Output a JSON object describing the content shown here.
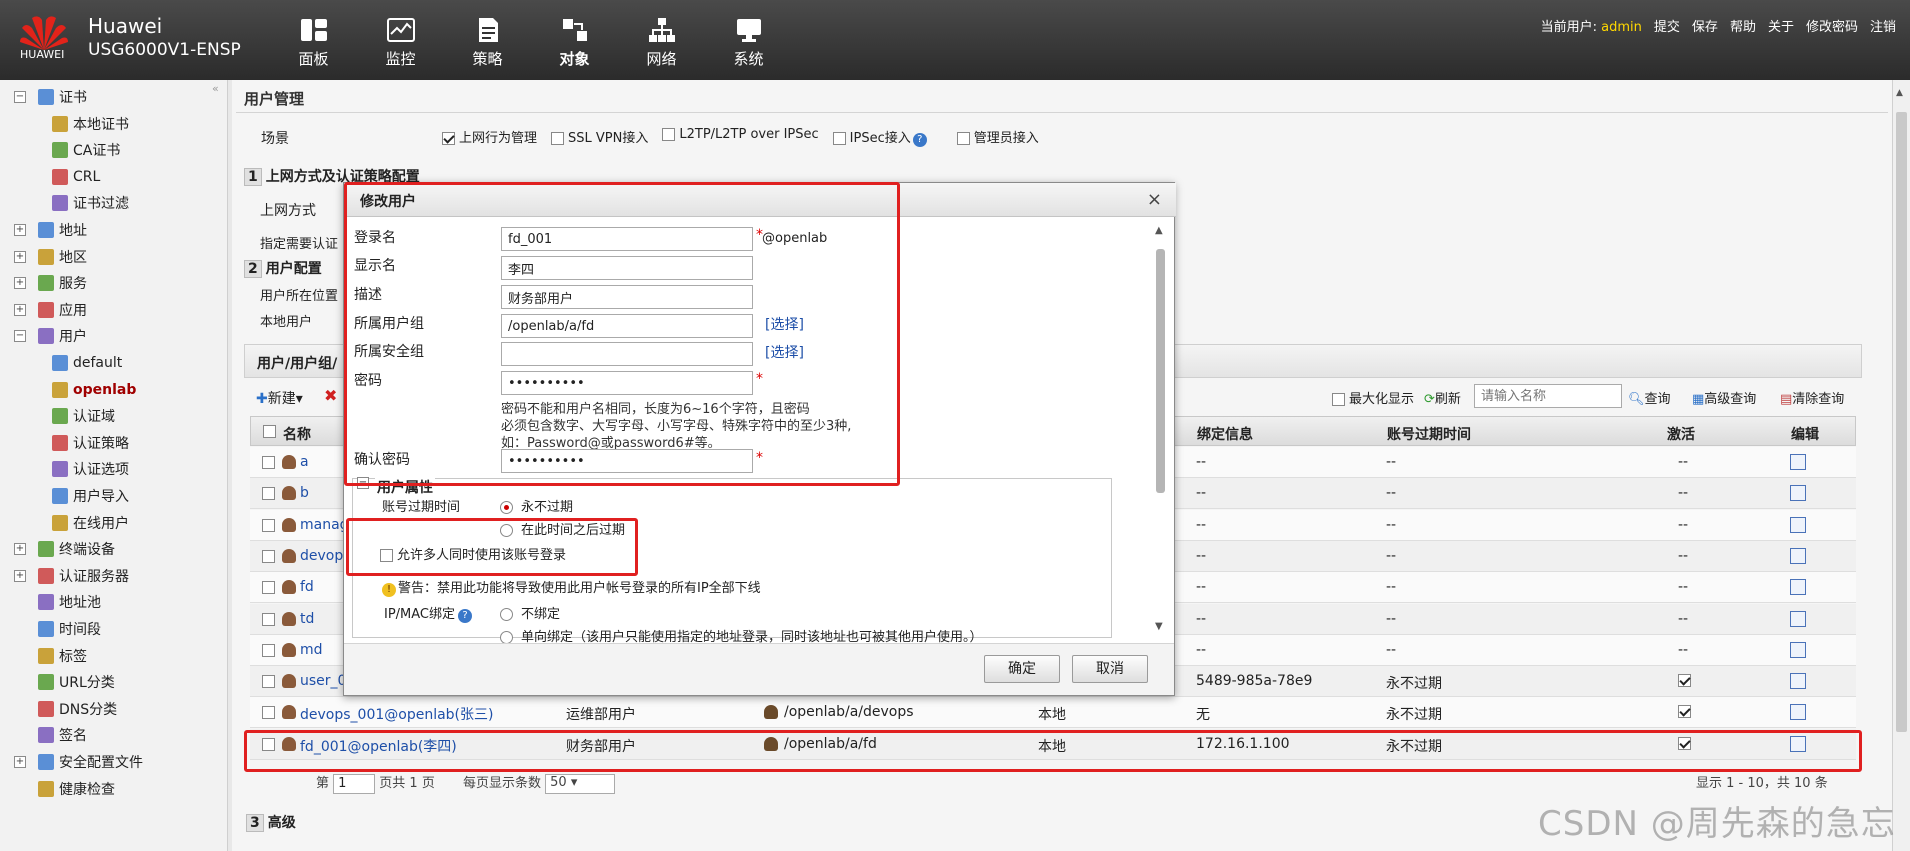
{
  "header": {
    "logo_text": "HUAWEI",
    "brand": "Huawei",
    "model": "USG6000V1-ENSP",
    "nav": [
      {
        "label": "面板",
        "icon": "dashboard-icon"
      },
      {
        "label": "监控",
        "icon": "monitor-icon"
      },
      {
        "label": "策略",
        "icon": "policy-icon"
      },
      {
        "label": "对象",
        "icon": "object-icon"
      },
      {
        "label": "网络",
        "icon": "network-icon"
      },
      {
        "label": "系统",
        "icon": "system-icon"
      }
    ],
    "current_user_label": "当前用户:",
    "current_user": "admin",
    "links": [
      "提交",
      "保存",
      "帮助",
      "关于",
      "修改密码",
      "注销"
    ]
  },
  "sidebar": {
    "items": [
      {
        "label": "证书",
        "level": 0,
        "expander": "−"
      },
      {
        "label": "本地证书",
        "level": 1
      },
      {
        "label": "CA证书",
        "level": 1
      },
      {
        "label": "CRL",
        "level": 1
      },
      {
        "label": "证书过滤",
        "level": 1
      },
      {
        "label": "地址",
        "level": 0,
        "expander": "+"
      },
      {
        "label": "地区",
        "level": 0,
        "expander": "+"
      },
      {
        "label": "服务",
        "level": 0,
        "expander": "+"
      },
      {
        "label": "应用",
        "level": 0,
        "expander": "+"
      },
      {
        "label": "用户",
        "level": 0,
        "expander": "−"
      },
      {
        "label": "default",
        "level": 1
      },
      {
        "label": "openlab",
        "level": 1,
        "active": true
      },
      {
        "label": "认证域",
        "level": 1
      },
      {
        "label": "认证策略",
        "level": 1
      },
      {
        "label": "认证选项",
        "level": 1
      },
      {
        "label": "用户导入",
        "level": 1
      },
      {
        "label": "在线用户",
        "level": 1
      },
      {
        "label": "终端设备",
        "level": 0,
        "expander": "+"
      },
      {
        "label": "认证服务器",
        "level": 0,
        "expander": "+"
      },
      {
        "label": "地址池",
        "level": 0
      },
      {
        "label": "时间段",
        "level": 0
      },
      {
        "label": "标签",
        "level": 0
      },
      {
        "label": "URL分类",
        "level": 0
      },
      {
        "label": "DNS分类",
        "level": 0
      },
      {
        "label": "签名",
        "level": 0
      },
      {
        "label": "安全配置文件",
        "level": 0,
        "expander": "+"
      },
      {
        "label": "健康检查",
        "level": 0
      }
    ]
  },
  "main": {
    "title": "用户管理",
    "scene_label": "场景",
    "scenes": [
      {
        "label": "上网行为管理",
        "checked": true
      },
      {
        "label": "SSL VPN接入",
        "checked": false
      },
      {
        "label": "L2TP/L2TP over IPSec",
        "checked": false
      },
      {
        "label": "IPSec接入",
        "checked": false
      },
      {
        "label": "管理员接入",
        "checked": false
      }
    ],
    "section1_num": "1",
    "section1": "上网方式及认证策略配置",
    "access_mode_label": "上网方式",
    "auth_required_label": "指定需要认证",
    "section2_num": "2",
    "section2": "用户配置",
    "user_location_label": "用户所在位置",
    "local_user_label": "本地用户",
    "group_panel_title": "用户/用户组/",
    "section3_num": "3",
    "section3": "高级"
  },
  "toolbar": {
    "new_label": "新建",
    "maximize_label": "最大化显示",
    "refresh_label": "刷新",
    "search_placeholder": "请输入名称",
    "query_label": "查询",
    "advanced_query_label": "高级查询",
    "clear_query_label": "清除查询"
  },
  "grid": {
    "columns": [
      "名称",
      "绑定信息",
      "账号过期时间",
      "激活",
      "编辑"
    ],
    "rows": [
      {
        "name": "a",
        "desc": "",
        "group": "",
        "source": "",
        "bind": "--",
        "expire": "--",
        "active": "--"
      },
      {
        "name": "b",
        "desc": "",
        "group": "",
        "source": "",
        "bind": "--",
        "expire": "--",
        "active": "--"
      },
      {
        "name": "manag",
        "desc": "",
        "group": "",
        "source": "",
        "bind": "--",
        "expire": "--",
        "active": "--"
      },
      {
        "name": "devops",
        "desc": "",
        "group": "",
        "source": "",
        "bind": "--",
        "expire": "--",
        "active": "--"
      },
      {
        "name": "fd",
        "desc": "",
        "group": "",
        "source": "",
        "bind": "--",
        "expire": "--",
        "active": "--"
      },
      {
        "name": "td",
        "desc": "",
        "group": "",
        "source": "",
        "bind": "--",
        "expire": "--",
        "active": "--"
      },
      {
        "name": "md",
        "desc": "",
        "group": "",
        "source": "",
        "bind": "--",
        "expire": "--",
        "active": "--"
      },
      {
        "name": "user_0",
        "desc": "",
        "group": "",
        "source": "",
        "bind": "5489-985a-78e9",
        "expire": "永不过期",
        "active": "check"
      },
      {
        "name": "devops_001@openlab(张三)",
        "desc": "运维部用户",
        "group": "/openlab/a/devops",
        "source": "本地",
        "bind": "无",
        "expire": "永不过期",
        "active": "check"
      },
      {
        "name": "fd_001@openlab(李四)",
        "desc": "财务部用户",
        "group": "/openlab/a/fd",
        "source": "本地",
        "bind": "172.16.1.100",
        "expire": "永不过期",
        "active": "check"
      }
    ]
  },
  "pager": {
    "page_prefix": "第",
    "page_value": "1",
    "page_suffix": "页共 1 页",
    "per_page_label": "每页显示条数",
    "per_page_value": "50",
    "summary": "显示 1 - 10，共 10 条"
  },
  "dialog": {
    "title": "修改用户",
    "close": "×",
    "login_label": "登录名",
    "login_value": "fd_001",
    "login_suffix": "@openlab",
    "display_label": "显示名",
    "display_value": "李四",
    "desc_label": "描述",
    "desc_value": "财务部用户",
    "group_label": "所属用户组",
    "group_value": "/openlab/a/fd",
    "select_label": "[选择]",
    "secgroup_label": "所属安全组",
    "secgroup_value": "",
    "password_label": "密码",
    "password_value": "••••••••••",
    "password_hint_1": "密码不能和用户名相同，长度为6~16个字符，且密码",
    "password_hint_2": "必须包含数字、大写字母、小写字母、特殊字符中的至少3种,",
    "password_hint_3": "如：Password@或password6#等。",
    "confirm_label": "确认密码",
    "confirm_value": "••••••••••",
    "required_mark": "*",
    "attr_title": "用户属性",
    "expire_label": "账号过期时间",
    "expire_never": "永不过期",
    "expire_after": "在此时间之后过期",
    "multi_login_label": "允许多人同时使用该账号登录",
    "warning": "警告：禁用此功能将导致使用此用户帐号登录的所有IP全部下线",
    "ipmac_label": "IP/MAC绑定",
    "unbind": "不绑定",
    "one_way": "单向绑定（该用户只能使用指定的地址登录，同时该地址也可被其他用户使用。）",
    "ok": "确定",
    "cancel": "取消"
  },
  "watermark": "CSDN @周先森的急忘"
}
